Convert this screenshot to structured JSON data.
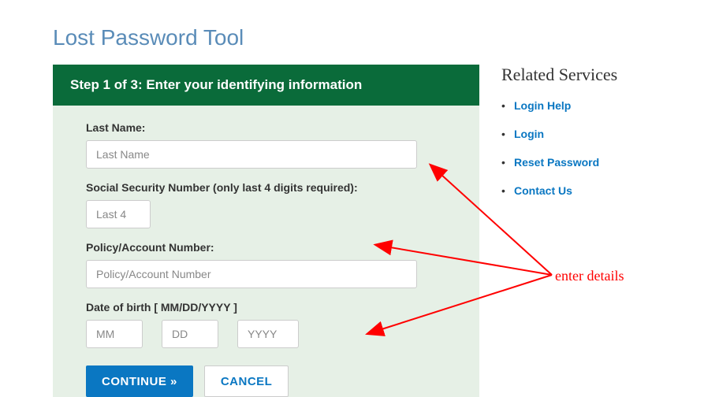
{
  "page_title": "Lost Password Tool",
  "step_header": "Step 1 of 3: Enter your identifying information",
  "fields": {
    "last_name": {
      "label": "Last Name:",
      "placeholder": "Last Name"
    },
    "ssn": {
      "label": "Social Security Number (only last 4 digits required):",
      "placeholder": "Last 4"
    },
    "policy": {
      "label": "Policy/Account Number:",
      "placeholder": "Policy/Account Number"
    },
    "dob": {
      "label": "Date of birth [ MM/DD/YYYY ]",
      "mm_placeholder": "MM",
      "dd_placeholder": "DD",
      "yyyy_placeholder": "YYYY"
    }
  },
  "buttons": {
    "continue": "CONTINUE »",
    "cancel": "CANCEL"
  },
  "sidebar": {
    "heading": "Related Services",
    "items": [
      {
        "label": "Login Help"
      },
      {
        "label": "Login"
      },
      {
        "label": "Reset Password"
      },
      {
        "label": "Contact Us"
      }
    ]
  },
  "annotation": {
    "label": "enter details"
  }
}
